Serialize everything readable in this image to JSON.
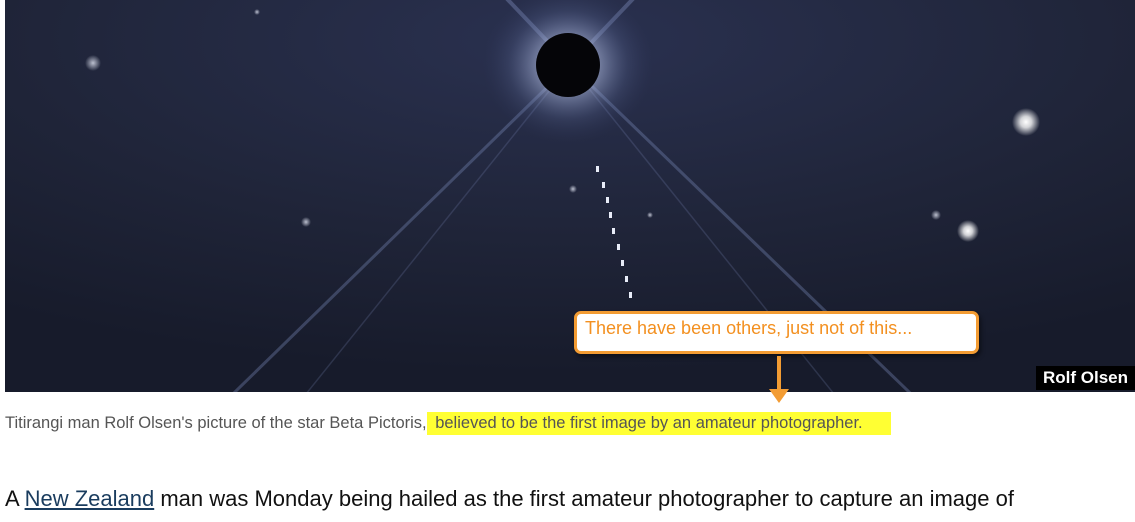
{
  "photo": {
    "subject": "Beta Pictoris star field",
    "credit": "Rolf Olsen"
  },
  "callout": {
    "text": "There have been others, just not of this..."
  },
  "caption": {
    "plain": "Titirangi man Rolf Olsen's picture of the star Beta Pictoris,",
    "highlighted": " believed to be the first image by an amateur photographer."
  },
  "article": {
    "lead_prefix": "A ",
    "link_text": "New Zealand",
    "lead_suffix": " man was Monday being hailed as the first amateur photographer to capture an image of"
  },
  "colors": {
    "callout_border": "#f39c33",
    "callout_text": "#f39020",
    "highlight": "#ffff33",
    "sky": "#1f2438"
  }
}
